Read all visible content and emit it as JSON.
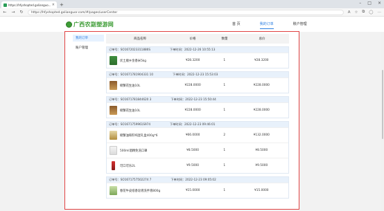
{
  "browser": {
    "tab_title": "https://hfyshopted.gxlianguo...",
    "new_tab": "+",
    "url": "https://hfyshopted.gxlianguor.com/#/pages/userCenter"
  },
  "site": {
    "logo_text": "广西农副塑游网",
    "nav": [
      "首 页",
      "我的订单",
      "账户管理"
    ]
  },
  "sidebar": {
    "items": [
      "我的订单",
      "账户管理"
    ]
  },
  "table": {
    "headers": [
      "商品名称",
      "价格",
      "数量",
      "总价"
    ]
  },
  "orders": [
    {
      "no": "订单号：SO1672023311886S",
      "time": "下单时间：2022-12-26 10:55:13",
      "items": [
        {
          "name": "优土顺乡金香米5kg",
          "price": "¥28.3200",
          "qty": "1",
          "total": "¥28.3200",
          "img": "rice"
        }
      ]
    },
    {
      "no": "订单号：SO1671781904331 10",
      "time": "下单时间：2022-12-23 15:53:03",
      "items": [
        {
          "name": "螃蟹花生油10L",
          "price": "¥228.0000",
          "qty": "1",
          "total": "¥228.0000",
          "img": "oil"
        }
      ]
    },
    {
      "no": "订单号：SO1671781844620 3",
      "time": "下单时间：2022-12-23 15:50:44",
      "items": [
        {
          "name": "螃蟹花生油10L",
          "price": "¥228.0000",
          "qty": "1",
          "total": "¥228.0000",
          "img": "oil"
        }
      ]
    },
    {
      "no": "订单号：SO1671759961S974",
      "time": "下单时间：2022-12-23 09:46:01",
      "items": [
        {
          "name": "螃蟹油和籽纯混礼盒400g*6",
          "price": "¥66.0000",
          "qty": "2",
          "total": "¥132.0000",
          "img": "gift"
        },
        {
          "name": "500ml酒精免洗口罩",
          "price": "¥8.5000",
          "qty": "1",
          "total": "¥8.5000",
          "img": "mask"
        },
        {
          "name": "可口可乐2L",
          "price": "¥9.5000",
          "qty": "1",
          "total": "¥9.5000",
          "img": "cola"
        }
      ]
    },
    {
      "no": "订单号：SO1671757502274 7",
      "time": "下单时间：2022-12-23 09:05:02",
      "items": [
        {
          "name": "春花牛皮纸香皂液洗手液800g",
          "price": "¥15.0000",
          "qty": "1",
          "total": "¥15.0000",
          "img": "soap"
        }
      ]
    }
  ]
}
